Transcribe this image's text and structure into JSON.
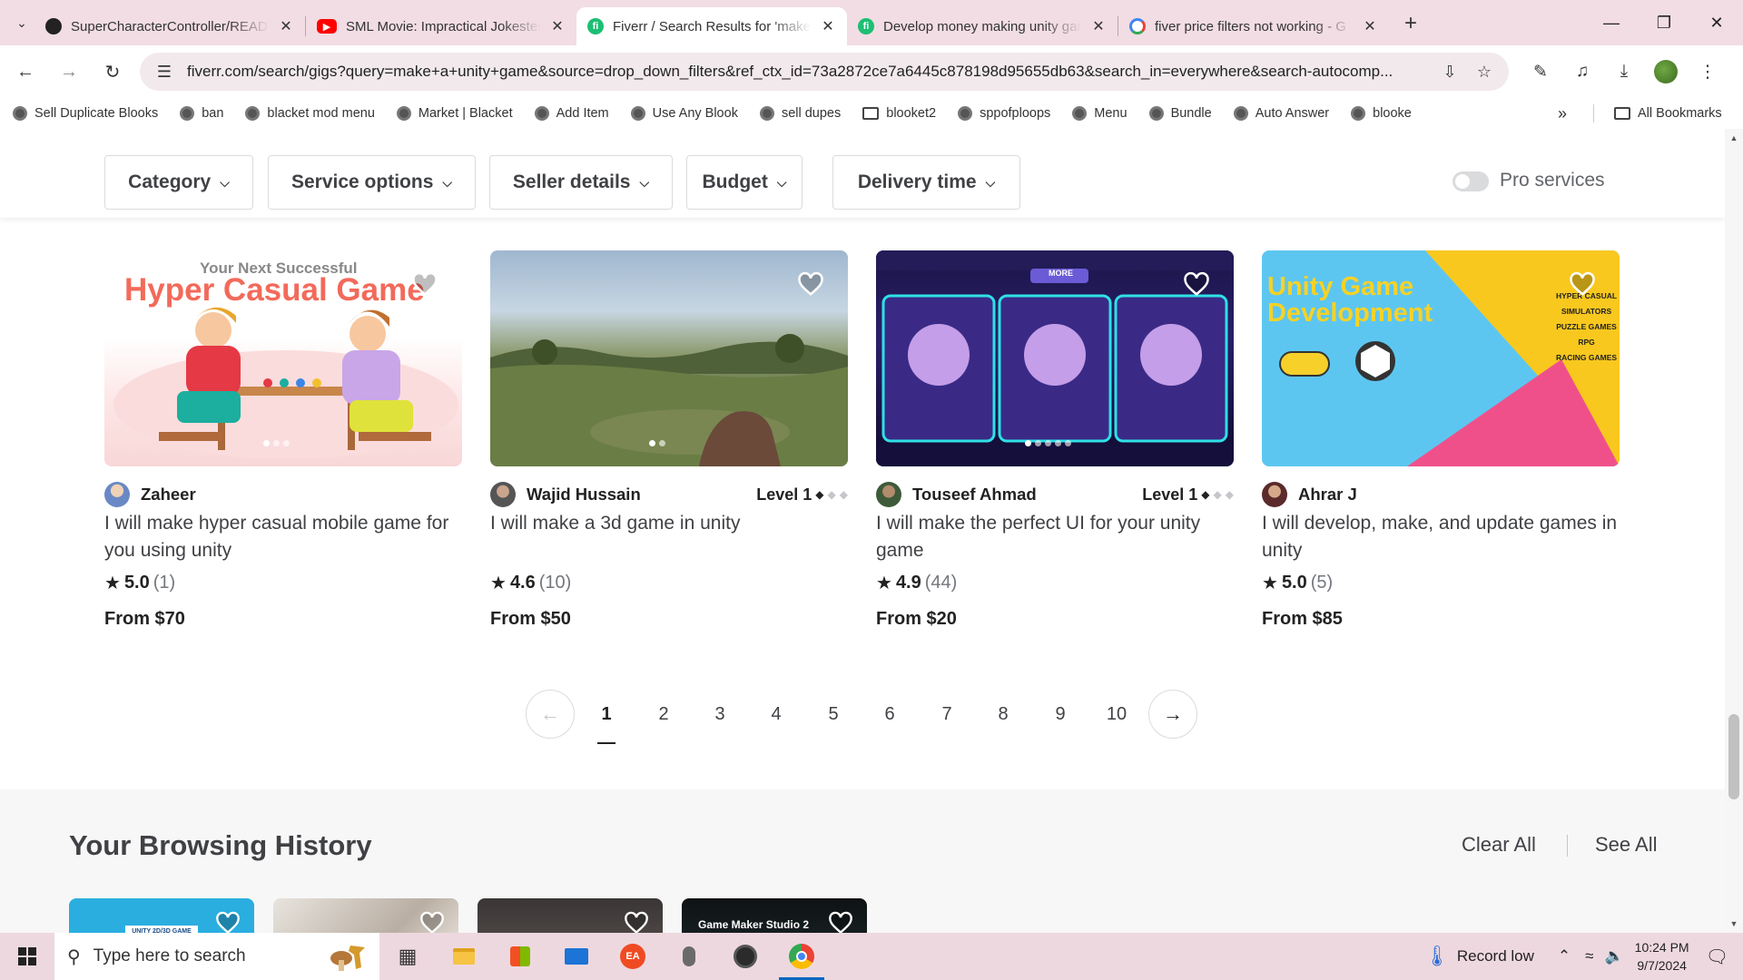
{
  "browser": {
    "tabs": [
      {
        "title": "SuperCharacterController/README",
        "favicon": "github-icon",
        "active": false
      },
      {
        "title": "SML Movie: Impractical Jokesters",
        "favicon": "youtube-icon",
        "active": false
      },
      {
        "title": "Fiverr / Search Results for 'make",
        "favicon": "fiverr-icon",
        "active": true
      },
      {
        "title": "Develop money making unity game",
        "favicon": "fiverr-icon",
        "active": false
      },
      {
        "title": "fiver price filters not working - G",
        "favicon": "google-icon",
        "active": false
      }
    ],
    "url": "fiverr.com/search/gigs?query=make+a+unity+game&source=drop_down_filters&ref_ctx_id=73a2872ce7a6445c878198d95655db63&search_in=everywhere&search-autocomp...",
    "bookmarks": [
      {
        "label": "Sell Duplicate Blooks",
        "type": "site"
      },
      {
        "label": "ban",
        "type": "site"
      },
      {
        "label": "blacket mod menu",
        "type": "site"
      },
      {
        "label": "Market | Blacket",
        "type": "site"
      },
      {
        "label": "Add Item",
        "type": "site"
      },
      {
        "label": "Use Any Blook",
        "type": "site"
      },
      {
        "label": "sell dupes",
        "type": "site"
      },
      {
        "label": "blooket2",
        "type": "folder"
      },
      {
        "label": "sppofploops",
        "type": "site"
      },
      {
        "label": "Menu",
        "type": "site"
      },
      {
        "label": "Bundle",
        "type": "site"
      },
      {
        "label": "Auto Answer",
        "type": "site"
      },
      {
        "label": "blooke",
        "type": "site"
      }
    ],
    "all_bookmarks_label": "All Bookmarks",
    "more_label": "»"
  },
  "filters": {
    "buttons": [
      "Category",
      "Service options",
      "Seller details",
      "Budget",
      "Delivery time"
    ],
    "pro_services_label": "Pro services"
  },
  "gigs": [
    {
      "seller": "Zaheer",
      "level": "",
      "title": "I will make hyper casual mobile game for you using unity",
      "score": "5.0",
      "count": "(1)",
      "price": "From $70",
      "thumb_text_small": "Your Next Successful",
      "thumb_text_big": "Hyper Casual Game"
    },
    {
      "seller": "Wajid Hussain",
      "level": "Level 1",
      "level_value": 1,
      "title": "I will make a 3d game in unity",
      "score": "4.6",
      "count": "(10)",
      "price": "From $50"
    },
    {
      "seller": "Touseef Ahmad",
      "level": "Level 1",
      "level_value": 1,
      "title": "I will make the perfect UI for your unity game",
      "score": "4.9",
      "count": "(44)",
      "price": "From $20",
      "thumb_text_small": "MORE"
    },
    {
      "seller": "Ahrar J",
      "level": "",
      "title": "I will develop, make, and update games in unity",
      "score": "5.0",
      "count": "(5)",
      "price": "From $85",
      "thumb_text_big": "Unity Game Development",
      "thumb_list": [
        "HYPER CASUAL",
        "SIMULATORS",
        "PUZZLE GAMES",
        "RPG",
        "RACING GAMES"
      ]
    }
  ],
  "pagination": {
    "pages": [
      "1",
      "2",
      "3",
      "4",
      "5",
      "6",
      "7",
      "8",
      "9",
      "10"
    ],
    "current": "1",
    "prev_label": "←",
    "next_label": "→"
  },
  "history": {
    "title": "Your Browsing History",
    "clear_all": "Clear All",
    "see_all": "See All",
    "thumb_labels": [
      "UNITY 2D/3D GAME",
      "",
      "",
      "Game Maker Studio 2"
    ]
  },
  "taskbar": {
    "search_placeholder": "Type here to search",
    "weather_label": "Record low",
    "time": "10:24 PM",
    "date": "9/7/2024"
  },
  "colors": {
    "fiverr_green": "#1dbf73",
    "tab_strip": "#f1dde3",
    "taskbar": "#eed8df"
  }
}
